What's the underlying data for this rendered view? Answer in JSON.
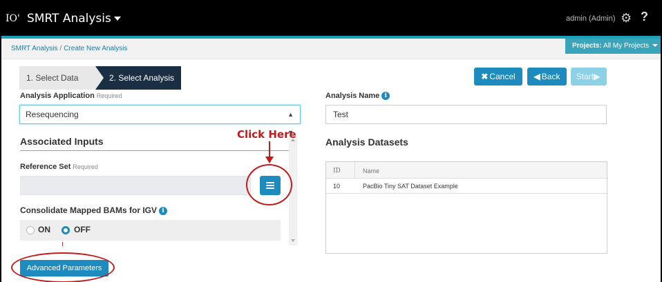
{
  "navbar": {
    "brand_fragment": "IO'",
    "app_name": "SMRT Analysis",
    "user": "admin (Admin)",
    "gear_icon": "gear-icon",
    "help_icon": "?"
  },
  "breadcrumb": {
    "root": "SMRT Analysis",
    "separator": "/",
    "current": "Create New Analysis"
  },
  "projects": {
    "label": "Projects:",
    "value": "All My Projects"
  },
  "steps": {
    "step1": "1. Select Data",
    "step2": "2. Select Analysis"
  },
  "buttons": {
    "cancel": "Cancel",
    "back": "Back",
    "start": "Start"
  },
  "analysis_application": {
    "label": "Analysis Application",
    "required": "Required",
    "value": "Resequencing"
  },
  "analysis_name": {
    "label": "Analysis Name",
    "value": "Test"
  },
  "associated_inputs": {
    "title": "Associated Inputs",
    "reference_set_label": "Reference Set",
    "reference_set_required": "Required",
    "reference_set_value": "",
    "consolidate_label": "Consolidate Mapped BAMs for IGV",
    "on_label": "ON",
    "off_label": "OFF",
    "selected": "OFF"
  },
  "advanced_parameters": "Advanced Parameters",
  "annotation": {
    "click_here": "Click Here"
  },
  "datasets": {
    "title": "Analysis Datasets",
    "columns": [
      "ID",
      "Name"
    ],
    "rows": [
      {
        "id": "10",
        "name": "PacBio Tiny SAT Dataset Example"
      }
    ]
  },
  "colors": {
    "navbar": "#000000",
    "accent": "#1d8bbd",
    "teal": "#1aa3b8",
    "annotation_red": "#c31a1a"
  }
}
